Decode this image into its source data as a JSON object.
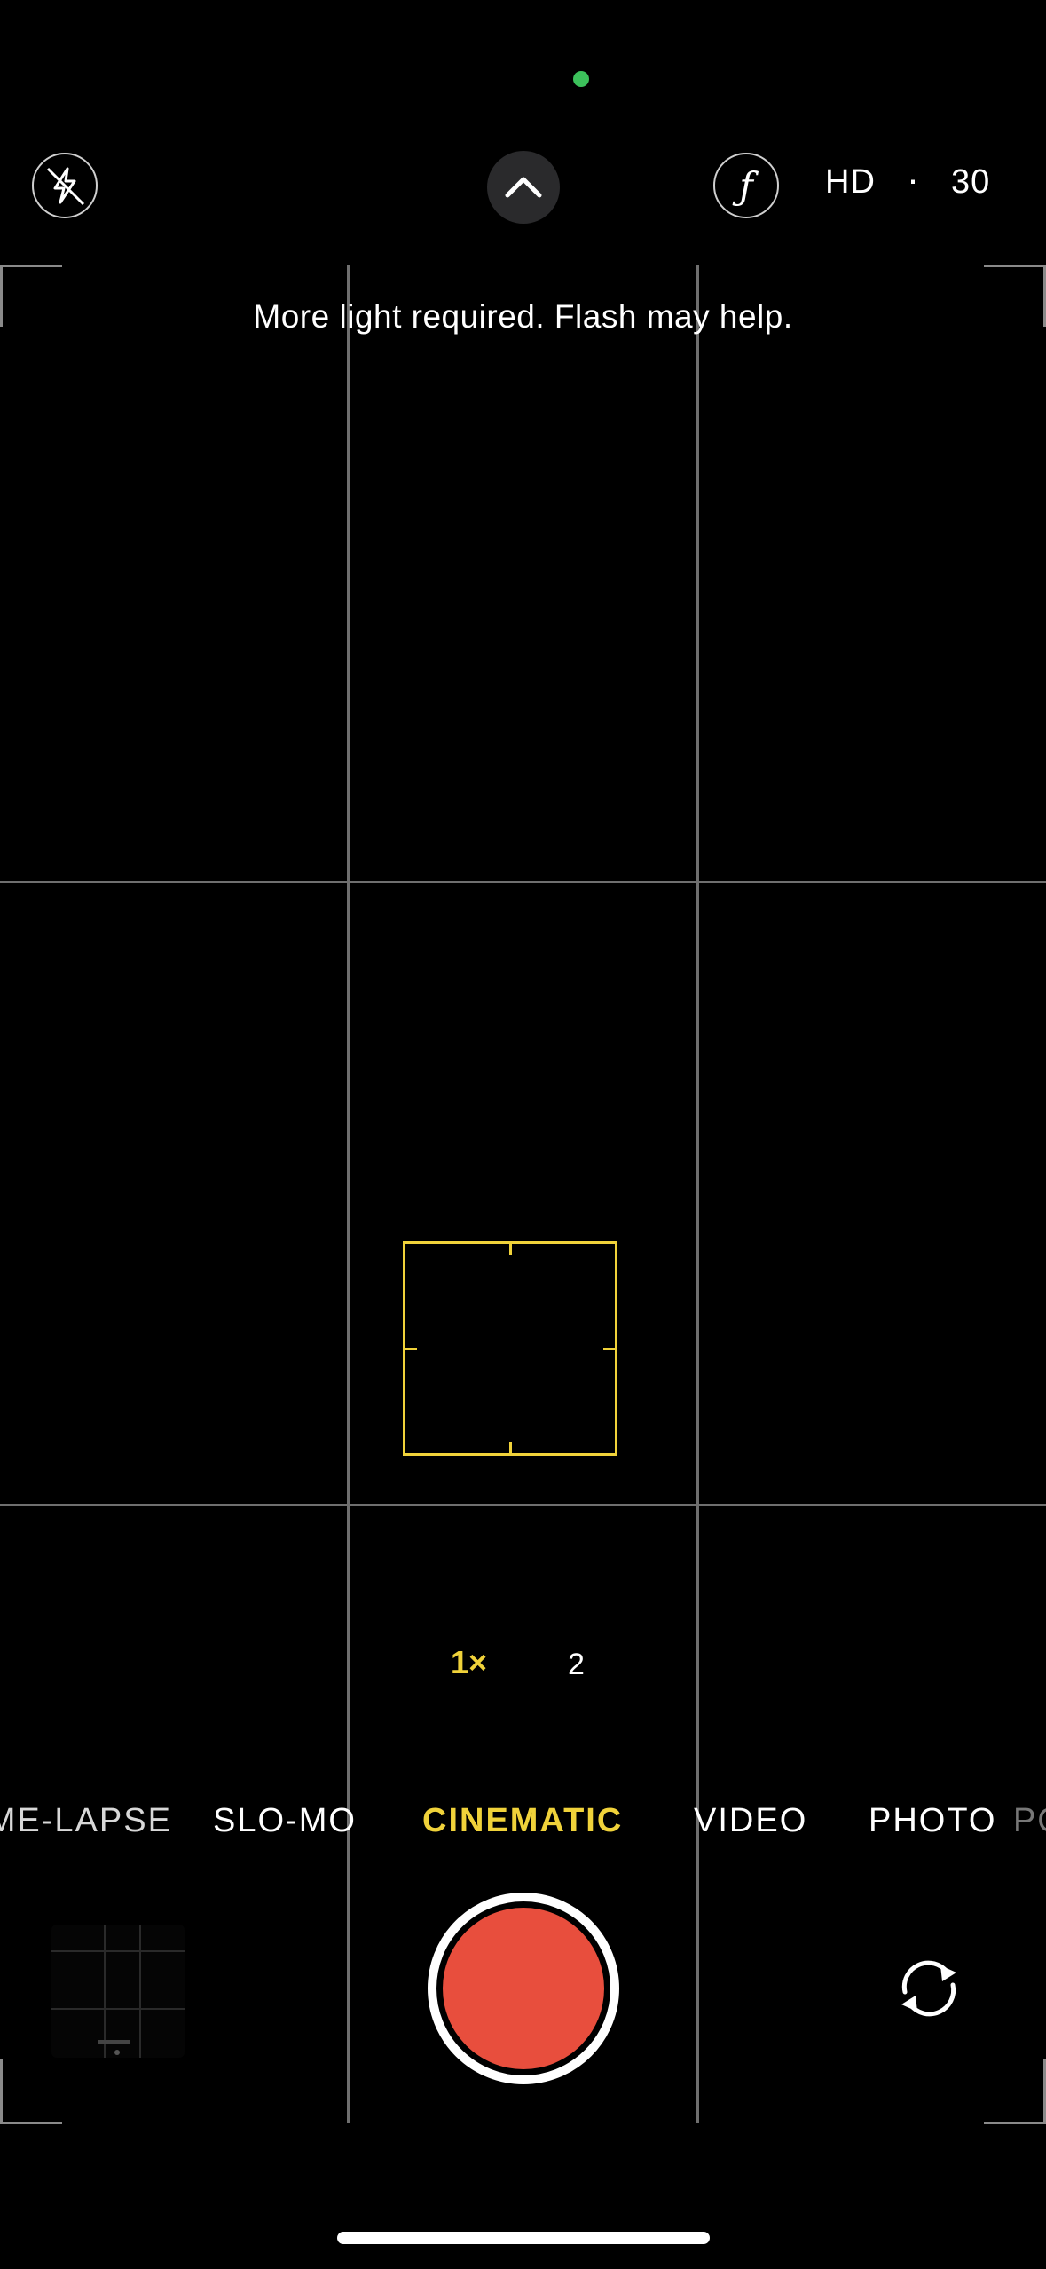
{
  "status": {
    "indicator_color": "#3cc15b"
  },
  "top_bar": {
    "flash_icon": "flash-off-icon",
    "chevron_icon": "chevron-up-icon",
    "aperture_icon": "aperture-f-icon",
    "aperture_symbol": "ƒ",
    "resolution": "HD",
    "separator": "·",
    "frame_rate": "30"
  },
  "message": "More light required. Flash may help.",
  "zoom": {
    "selected": "1×",
    "other": "2",
    "accent_color": "#f0d23a"
  },
  "modes": {
    "items": [
      "TIME-LAPSE",
      "SLO-MO",
      "CINEMATIC",
      "VIDEO",
      "PHOTO",
      "PORTRAIT"
    ],
    "selected": "CINEMATIC"
  },
  "shutter": {
    "color": "#e84e3d"
  },
  "switch_camera_icon": "camera-flip-icon",
  "thumbnail_icon": "last-photo-thumbnail"
}
